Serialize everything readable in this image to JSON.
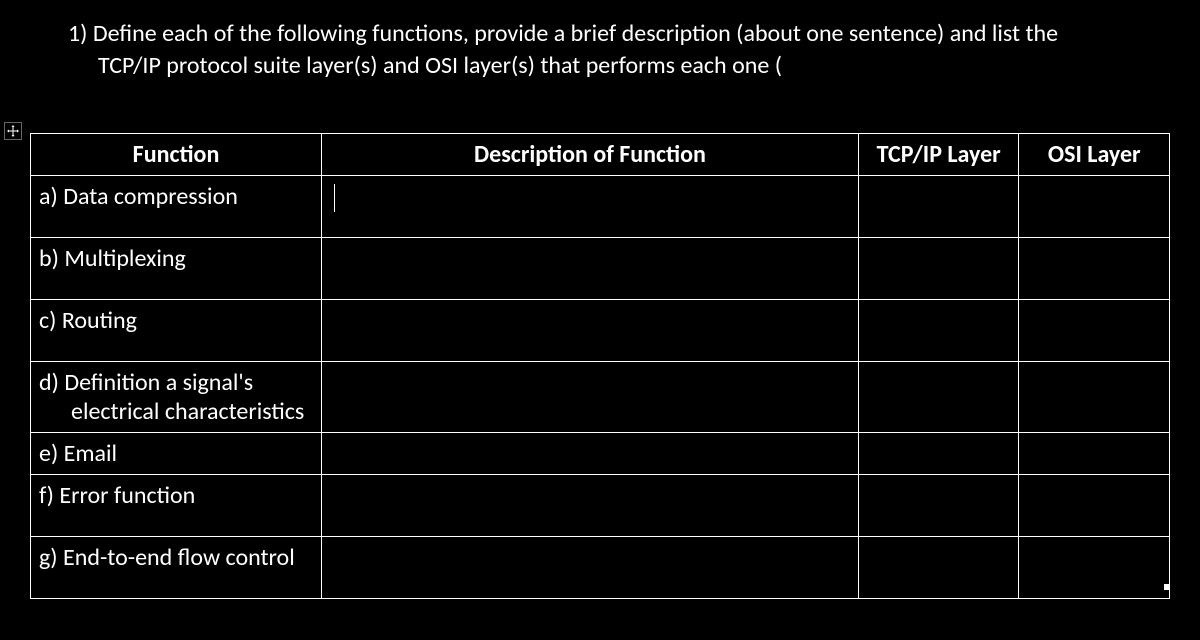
{
  "question": {
    "number": "1)",
    "line1": "Define each of the following functions, provide a brief description (about one sentence) and list the",
    "line2": "TCP/IP protocol suite layer(s) and OSI layer(s) that performs each one ("
  },
  "headers": {
    "function": "Function",
    "description": "Description of Function",
    "tcpip": "TCP/IP Layer",
    "osi": "OSI Layer"
  },
  "rows": [
    {
      "label": "a) Data compression",
      "description": "",
      "tcpip": "",
      "osi": ""
    },
    {
      "label": "b) Multiplexing",
      "description": "",
      "tcpip": "",
      "osi": ""
    },
    {
      "label": "c) Routing",
      "description": "",
      "tcpip": "",
      "osi": ""
    },
    {
      "label": "d) Definition a signal's",
      "label_cont": "electrical characteristics",
      "description": "",
      "tcpip": "",
      "osi": ""
    },
    {
      "label": "e) Email",
      "description": "",
      "tcpip": "",
      "osi": ""
    },
    {
      "label": "f)  Error function",
      "description": "",
      "tcpip": "",
      "osi": ""
    },
    {
      "label": "g) End-to-end flow control",
      "description": "",
      "tcpip": "",
      "osi": ""
    }
  ]
}
